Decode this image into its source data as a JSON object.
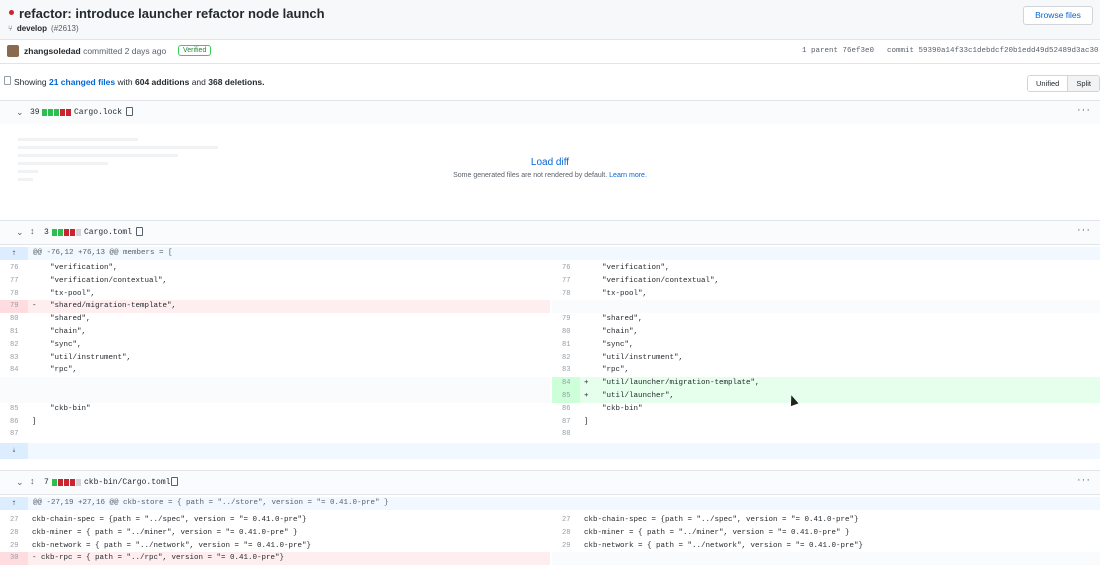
{
  "header": {
    "title": "refactor: introduce launcher refactor node launch",
    "branch": "develop",
    "pr": "(#2613)",
    "browse_label": "Browse files"
  },
  "meta": {
    "author": "zhangsoledad",
    "committed": "committed 2 days ago",
    "verified": "Verified",
    "parent_label": "1 parent",
    "parent_sha": "76ef3e0",
    "commit_label": "commit",
    "commit_sha": "59390a14f33c1debdcf20b1edd49d52489d3ac30"
  },
  "stats": {
    "prefix": "Showing",
    "changed": "21 changed files",
    "with": "with",
    "additions": "604 additions",
    "and": "and",
    "deletions": "368 deletions.",
    "unified": "Unified",
    "split": "Split"
  },
  "files": [
    {
      "count": "39",
      "name": "Cargo.lock"
    },
    {
      "count": "3",
      "name": "Cargo.toml"
    },
    {
      "count": "7",
      "name": "ckb-bin/Cargo.toml"
    }
  ],
  "load_diff": {
    "link": "Load diff",
    "sub": "Some generated files are not rendered by default.",
    "learn": "Learn more."
  },
  "hunks": [
    "@@ -76,12 +76,13 @@ members = [",
    "@@ -27,19 +27,16 @@ ckb-store = { path = \"../store\", version = \"= 0.41.0-pre\" }"
  ],
  "diff1": [
    {
      "l": "76",
      "lc": "    \"verification\",",
      "r": "76",
      "rc": "    \"verification\","
    },
    {
      "l": "77",
      "lc": "    \"verification/contextual\",",
      "r": "77",
      "rc": "    \"verification/contextual\","
    },
    {
      "l": "78",
      "lc": "    \"tx-pool\",",
      "r": "78",
      "rc": "    \"tx-pool\","
    },
    {
      "l": "79",
      "lc": "-   \"shared/migration-template\",",
      "r": "",
      "rc": ""
    },
    {
      "l": "80",
      "lc": "    \"shared\",",
      "r": "79",
      "rc": "    \"shared\","
    },
    {
      "l": "81",
      "lc": "    \"chain\",",
      "r": "80",
      "rc": "    \"chain\","
    },
    {
      "l": "82",
      "lc": "    \"sync\",",
      "r": "81",
      "rc": "    \"sync\","
    },
    {
      "l": "83",
      "lc": "    \"util/instrument\",",
      "r": "82",
      "rc": "    \"util/instrument\","
    },
    {
      "l": "84",
      "lc": "    \"rpc\",",
      "r": "83",
      "rc": "    \"rpc\","
    },
    {
      "l": "",
      "lc": "",
      "r": "84",
      "rc": "+   \"util/launcher/migration-template\","
    },
    {
      "l": "",
      "lc": "",
      "r": "85",
      "rc": "+   \"util/launcher\","
    },
    {
      "l": "85",
      "lc": "    \"ckb-bin\"",
      "r": "86",
      "rc": "    \"ckb-bin\""
    },
    {
      "l": "86",
      "lc": "]",
      "r": "87",
      "rc": "]"
    },
    {
      "l": "87",
      "lc": "",
      "r": "88",
      "rc": ""
    }
  ],
  "diff2": [
    {
      "l": "27",
      "lc": "ckb-chain-spec = {path = \"../spec\", version = \"= 0.41.0-pre\"}",
      "r": "27",
      "rc": "ckb-chain-spec = {path = \"../spec\", version = \"= 0.41.0-pre\"}"
    },
    {
      "l": "28",
      "lc": "ckb-miner = { path = \"../miner\", version = \"= 0.41.0-pre\" }",
      "r": "28",
      "rc": "ckb-miner = { path = \"../miner\", version = \"= 0.41.0-pre\" }"
    },
    {
      "l": "29",
      "lc": "ckb-network = { path = \"../network\", version = \"= 0.41.0-pre\"}",
      "r": "29",
      "rc": "ckb-network = { path = \"../network\", version = \"= 0.41.0-pre\"}"
    },
    {
      "l": "30",
      "lc": "- ckb-rpc = { path = \"../rpc\", version = \"= 0.41.0-pre\"}",
      "r": "",
      "rc": ""
    }
  ],
  "icons": {
    "branch": "git-branch-icon",
    "copy": "clipboard-icon",
    "expand": "unfold-icon",
    "chevron": "chevron-down-icon",
    "more": "kebab-icon"
  }
}
